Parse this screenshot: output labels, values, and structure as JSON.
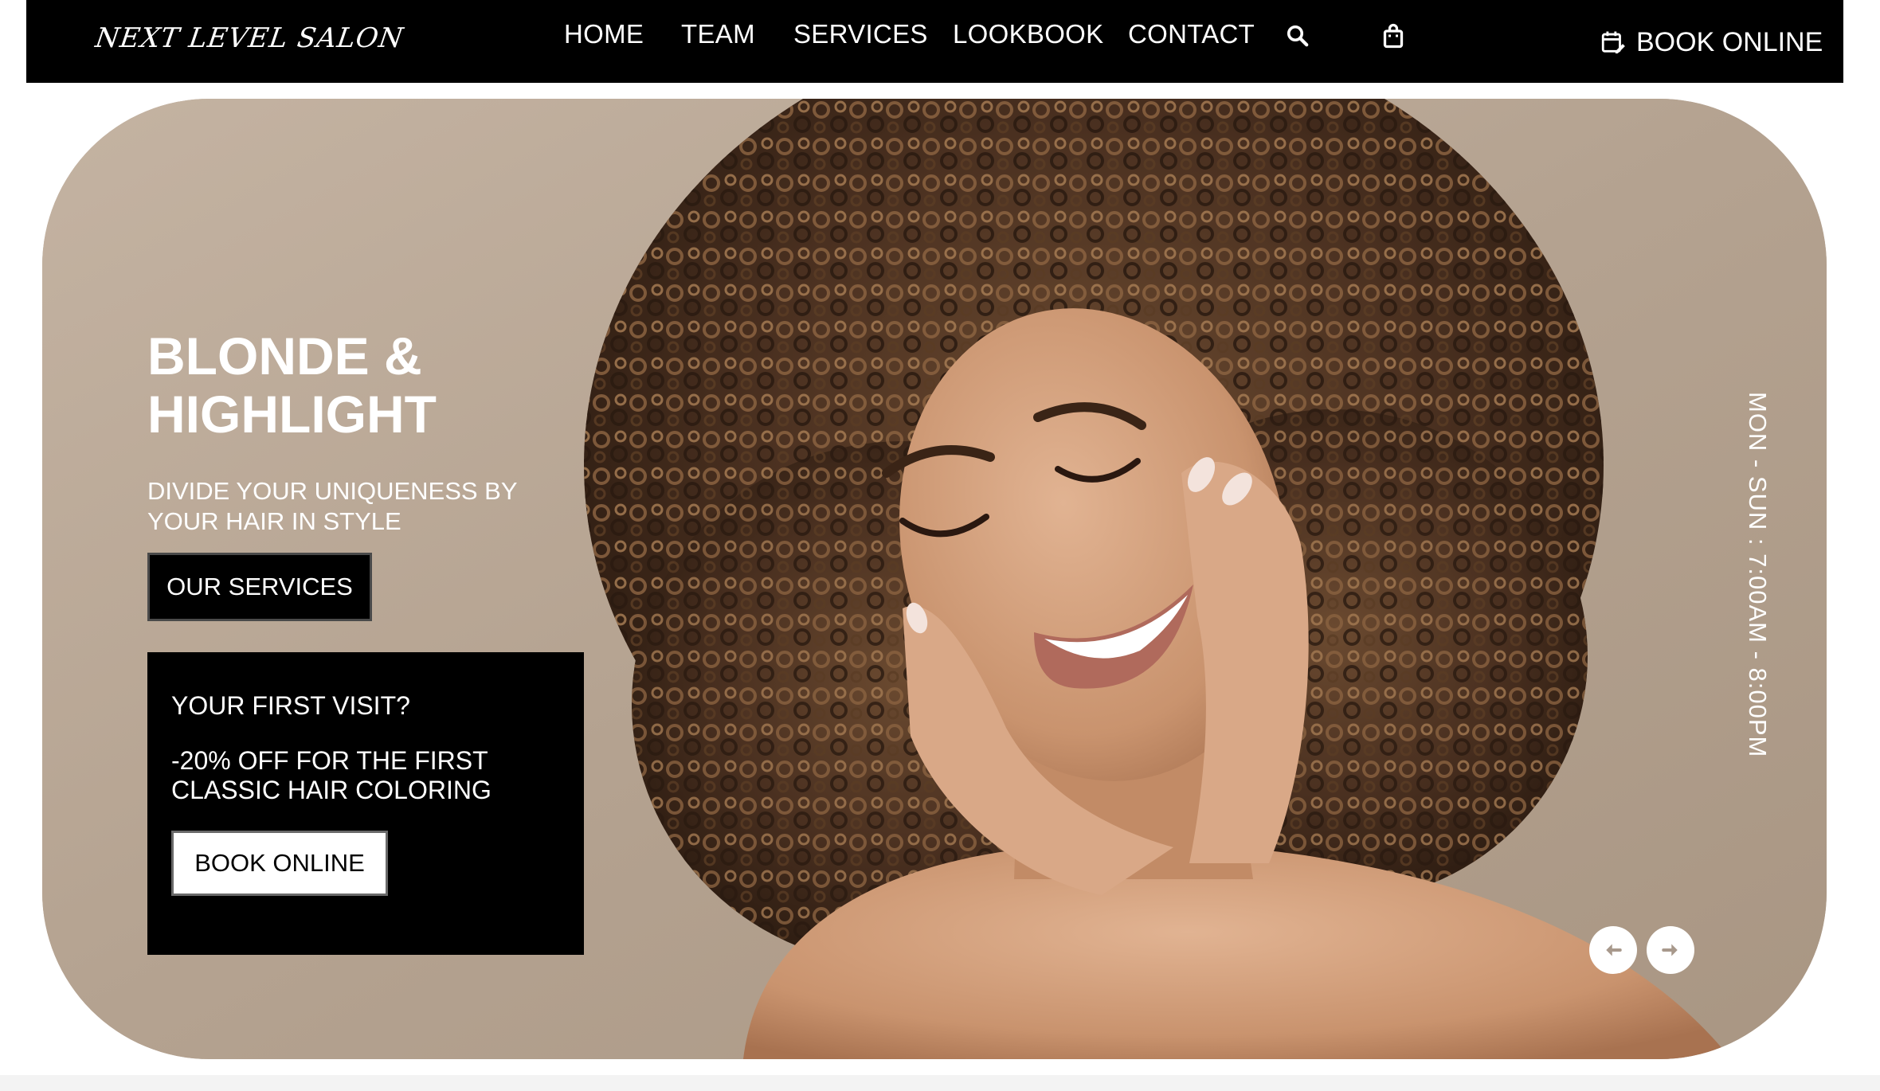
{
  "header": {
    "logo": "NEXT LEVEL SALON",
    "nav": [
      {
        "label": "HOME"
      },
      {
        "label": "TEAM"
      },
      {
        "label": "SERVICES"
      },
      {
        "label": "LOOKBOOK"
      },
      {
        "label": "CONTACT"
      }
    ],
    "search_icon": "search-icon",
    "cart_icon": "shopping-bag-icon",
    "book_online": {
      "icon": "calendar-edit-icon",
      "label": "BOOK ONLINE"
    }
  },
  "hero": {
    "title": "BLONDE & HIGHLIGHT",
    "subtitle": "DIVIDE YOUR UNIQUENESS BY YOUR HAIR IN STYLE",
    "services_button": "OUR SERVICES",
    "promo": {
      "heading": "YOUR FIRST VISIT?",
      "text": "-20% OFF FOR THE FIRST CLASSIC HAIR COLORING",
      "button": "BOOK ONLINE"
    },
    "hours": "MON - SUN : 7:00AM - 8:00PM",
    "prev_icon": "arrow-left-icon",
    "next_icon": "arrow-right-icon"
  },
  "colors": {
    "header_bg": "#000000",
    "hero_bg": "#b7a594",
    "text_light": "#ffffff",
    "promo_bg": "#000000"
  }
}
